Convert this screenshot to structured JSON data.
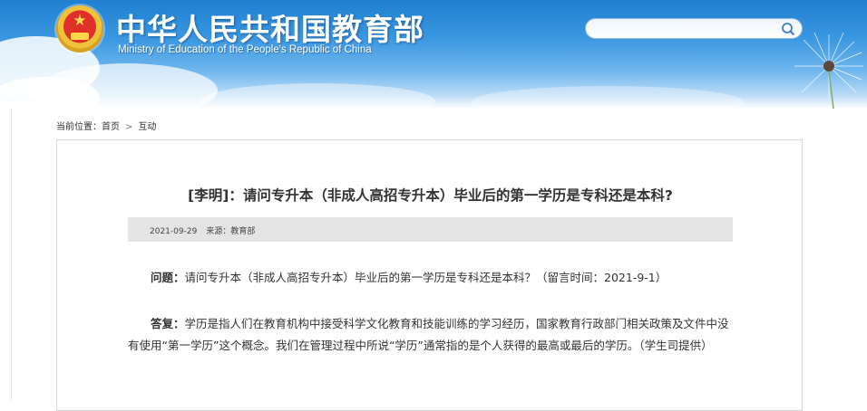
{
  "header": {
    "title": "中华人民共和国教育部",
    "subtitle": "Ministry of Education of the People's Republic of China",
    "search": {
      "value": "",
      "placeholder": ""
    }
  },
  "breadcrumb": {
    "prefix": "当前位置：",
    "home": "首页",
    "separator": ">",
    "current": "互动"
  },
  "article": {
    "title": "[李明]：请问专升本（非成人高招专升本）毕业后的第一学历是专科还是本科?",
    "date": "2021-09-29",
    "source": "来源：教育部",
    "question_label": "问题：",
    "question_text": "请问专升本（非成人高招专升本）毕业后的第一学历是专科还是本科？（留言时间：2021-9-1）",
    "answer_label": "答复：",
    "answer_text": "学历是指人们在教育机构中接受科学文化教育和技能训练的学习经历，国家教育行政部门相关政策及文件中没有使用“第一学历”这个概念。我们在管理过程中所说“学历”通常指的是个人获得的最高或最后的学历。（学生司提供）"
  },
  "colors": {
    "header_blue": "#2f8ad9",
    "meta_bar": "#e4e4e4",
    "text": "#333333"
  }
}
